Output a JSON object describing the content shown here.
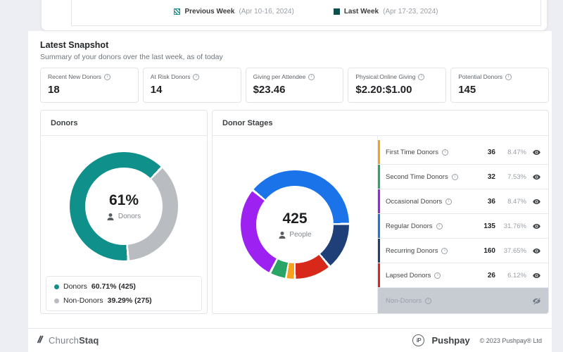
{
  "colors": {
    "page_bg": "#edeef3",
    "teal": "#10908b",
    "teal_dark": "#0d4f4d",
    "gray_slice": "#b9bdc1",
    "blue": "#1a73e8",
    "navy": "#1e3f78",
    "red": "#d7281a",
    "orange": "#f6a21d",
    "green": "#2ba566",
    "purple": "#9d22f1"
  },
  "top_legend": {
    "items": [
      {
        "label": "Previous Week",
        "dates": "(Apr 10-16, 2024)",
        "color": "#18938e"
      },
      {
        "label": "Last Week",
        "dates": "(Apr 17-23, 2024)",
        "color": "#0d4f4d"
      }
    ]
  },
  "snapshot": {
    "title": "Latest Snapshot",
    "subtitle": "Summary of your donors over the last week, as of today",
    "cards": [
      {
        "label": "Recent New Donors",
        "value": "18"
      },
      {
        "label": "At Risk Donors",
        "value": "14"
      },
      {
        "label": "Giving per Attendee",
        "value": "$23.46"
      },
      {
        "label": "Physical:Online Giving",
        "value": "$2.20:$1.00"
      },
      {
        "label": "Potential Donors",
        "value": "145"
      }
    ]
  },
  "donors_panel": {
    "title": "Donors",
    "center_value": "61%",
    "center_label": "Donors",
    "legend": [
      {
        "label": "Donors",
        "value": "60.71% (425)",
        "color": "#10908b"
      },
      {
        "label": "Non-Donors",
        "value": "39.29% (275)",
        "color": "#b9bdc1"
      }
    ],
    "segments": [
      {
        "color": "#10908b",
        "from": 0,
        "to": 43
      },
      {
        "color": "#ffffff",
        "from": 43,
        "to": 45.5
      },
      {
        "color": "#b9bdc1",
        "from": 45.5,
        "to": 174
      },
      {
        "color": "#ffffff",
        "from": 174,
        "to": 176.5
      },
      {
        "color": "#10908b",
        "from": 176.5,
        "to": 360
      }
    ]
  },
  "stages_panel": {
    "title": "Donor Stages",
    "center_value": "425",
    "center_label": "People",
    "rows": [
      {
        "label": "First Time Donors",
        "count": "36",
        "percent": "8.47%",
        "accent": "#f6a21d"
      },
      {
        "label": "Second Time Donors",
        "count": "32",
        "percent": "7.53%",
        "accent": "#2ba566"
      },
      {
        "label": "Occasional Donors",
        "count": "36",
        "percent": "8.47%",
        "accent": "#9d22f1"
      },
      {
        "label": "Regular Donors",
        "count": "135",
        "percent": "31.76%",
        "accent": "#1a73e8"
      },
      {
        "label": "Recurring Donors",
        "count": "160",
        "percent": "37.65%",
        "accent": "#1e3f78"
      },
      {
        "label": "Lapsed Donors",
        "count": "26",
        "percent": "6.12%",
        "accent": "#d7281a"
      }
    ],
    "disabled_row": {
      "label": "Non-Donors"
    },
    "segments": [
      {
        "color": "#1a73e8",
        "from": 0,
        "to": 88
      },
      {
        "color": "#ffffff",
        "from": 88,
        "to": 90.5
      },
      {
        "color": "#1e3f78",
        "from": 90.5,
        "to": 139
      },
      {
        "color": "#ffffff",
        "from": 139,
        "to": 141.5
      },
      {
        "color": "#d7281a",
        "from": 141.5,
        "to": 179
      },
      {
        "color": "#ffffff",
        "from": 179,
        "to": 181
      },
      {
        "color": "#f6a21d",
        "from": 181,
        "to": 188.5
      },
      {
        "color": "#ffffff",
        "from": 188.5,
        "to": 190.5
      },
      {
        "color": "#2ba566",
        "from": 190.5,
        "to": 206
      },
      {
        "color": "#ffffff",
        "from": 206,
        "to": 208.5
      },
      {
        "color": "#9d22f1",
        "from": 208.5,
        "to": 308
      },
      {
        "color": "#ffffff",
        "from": 308,
        "to": 310.5
      },
      {
        "color": "#1a73e8",
        "from": 310.5,
        "to": 360
      }
    ]
  },
  "footer": {
    "brand_church": "Church",
    "brand_staq": "Staq",
    "pp_mark": "iP",
    "pp_name": "Pushpay",
    "copyright": "© 2023 Pushpay® Ltd"
  },
  "chart_data": [
    {
      "type": "pie",
      "title": "Donors",
      "center_value": "61%",
      "center_label": "Donors",
      "series": [
        {
          "name": "Donors",
          "count": 425,
          "percent": 60.71,
          "color": "#10908b"
        },
        {
          "name": "Non-Donors",
          "count": 275,
          "percent": 39.29,
          "color": "#b9bdc1"
        }
      ]
    },
    {
      "type": "pie",
      "title": "Donor Stages",
      "center_value": "425",
      "center_label": "People",
      "total": 425,
      "series": [
        {
          "name": "First Time Donors",
          "count": 36,
          "percent": 8.47,
          "color": "#f6a21d"
        },
        {
          "name": "Second Time Donors",
          "count": 32,
          "percent": 7.53,
          "color": "#2ba566"
        },
        {
          "name": "Occasional Donors",
          "count": 36,
          "percent": 8.47,
          "color": "#9d22f1"
        },
        {
          "name": "Regular Donors",
          "count": 135,
          "percent": 31.76,
          "color": "#1a73e8"
        },
        {
          "name": "Recurring Donors",
          "count": 160,
          "percent": 37.65,
          "color": "#1e3f78"
        },
        {
          "name": "Lapsed Donors",
          "count": 26,
          "percent": 6.12,
          "color": "#d7281a"
        }
      ],
      "hidden_series": [
        "Non-Donors"
      ]
    }
  ]
}
